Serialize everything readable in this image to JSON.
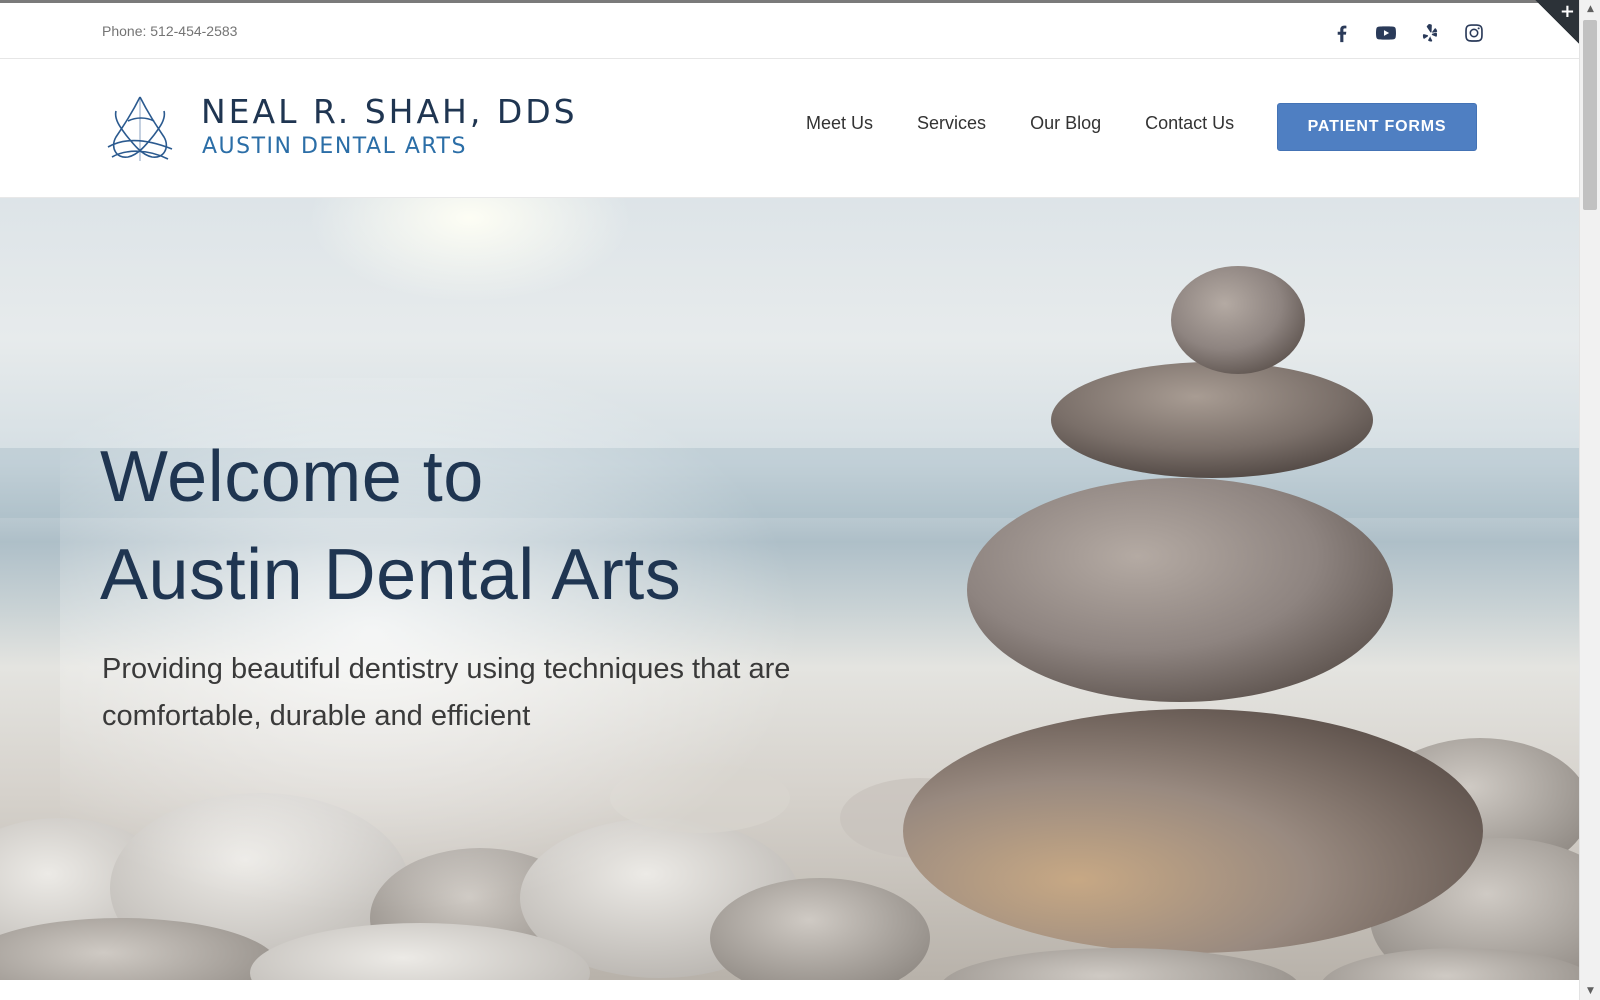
{
  "topbar": {
    "phone": "Phone: 512-454-2583",
    "social_icons": [
      "facebook-icon",
      "youtube-icon",
      "yelp-icon",
      "instagram-icon"
    ]
  },
  "header": {
    "logo_name": "NEAL R. SHAH, DDS",
    "logo_subtitle": "AUSTIN DENTAL ARTS",
    "nav": [
      "Meet Us",
      "Services",
      "Our Blog",
      "Contact Us"
    ],
    "cta_label": "PATIENT FORMS"
  },
  "hero": {
    "title_line1": "Welcome to",
    "title_line2": "Austin Dental Arts",
    "subtitle": "Providing beautiful dentistry using techniques that are comfortable, durable and efficient"
  },
  "corner_toggle": "+",
  "colors": {
    "brand_navy": "#1f3551",
    "brand_blue": "#2b6ea7",
    "cta_blue": "#4f7fc2",
    "text_gray": "#747474"
  }
}
